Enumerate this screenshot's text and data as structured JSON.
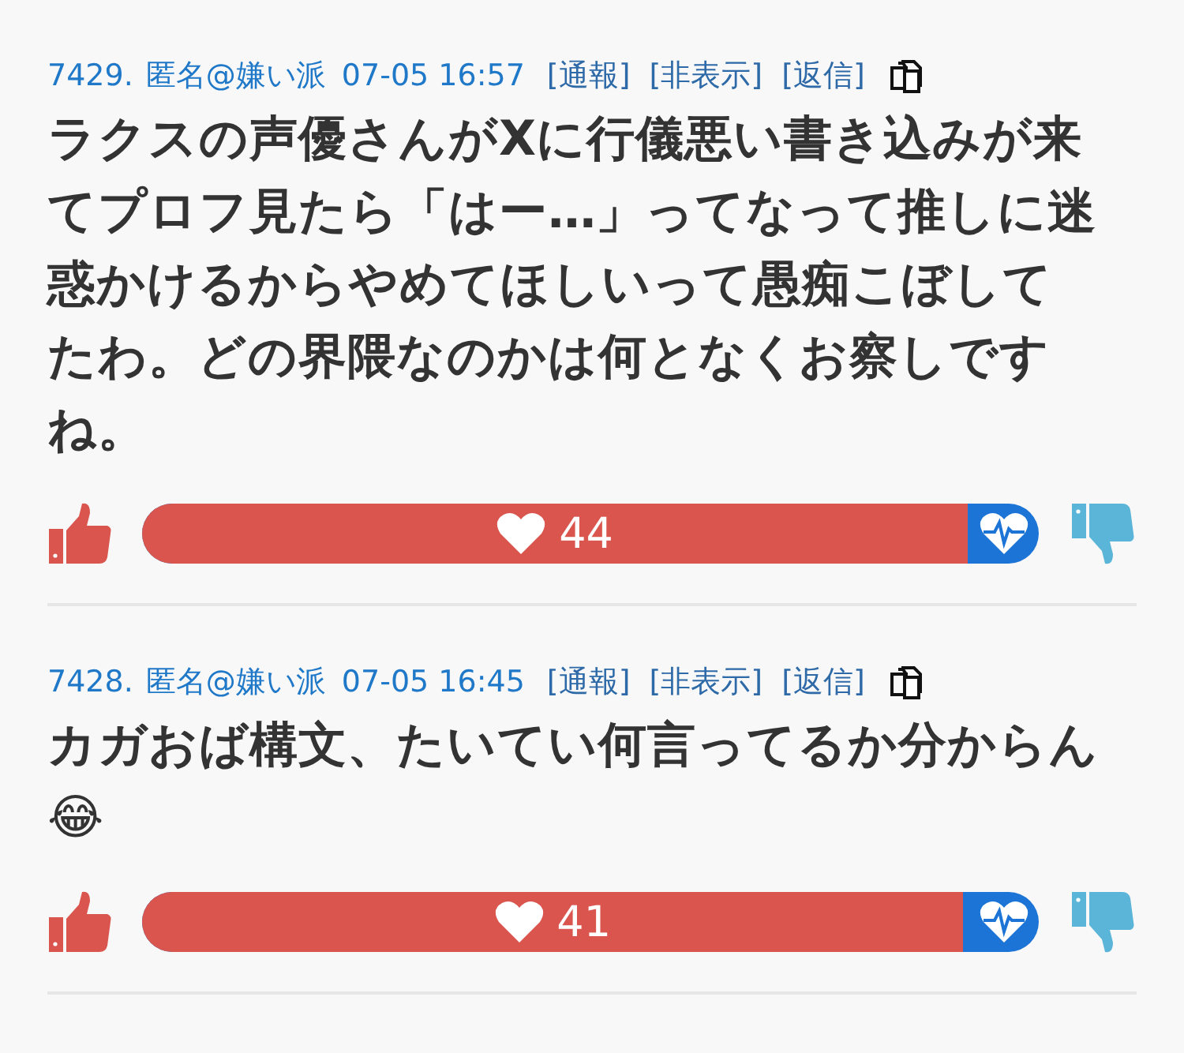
{
  "posts": [
    {
      "number": "7429.",
      "author": "匿名@嫌い派",
      "time": "07-05 16:57",
      "actions": [
        "[通報]",
        "[非表示]",
        "[返信]"
      ],
      "body": "ラクスの声優さんがXに行儀悪い書き込みが来てプロフ見たら「はー…」ってなって推しに迷惑かけるからやめてほしいって愚痴こぼしてたわ。どの界隈なのかは何となくお察しですね。",
      "likes": "44",
      "level": 0.92
    },
    {
      "number": "7428.",
      "author": "匿名@嫌い派",
      "time": "07-05 16:45",
      "actions": [
        "[通報]",
        "[非表示]",
        "[返信]"
      ],
      "body": "カガおば構文、たいてい何言ってるか分からん😂",
      "likes": "41",
      "level": 0.915
    }
  ]
}
